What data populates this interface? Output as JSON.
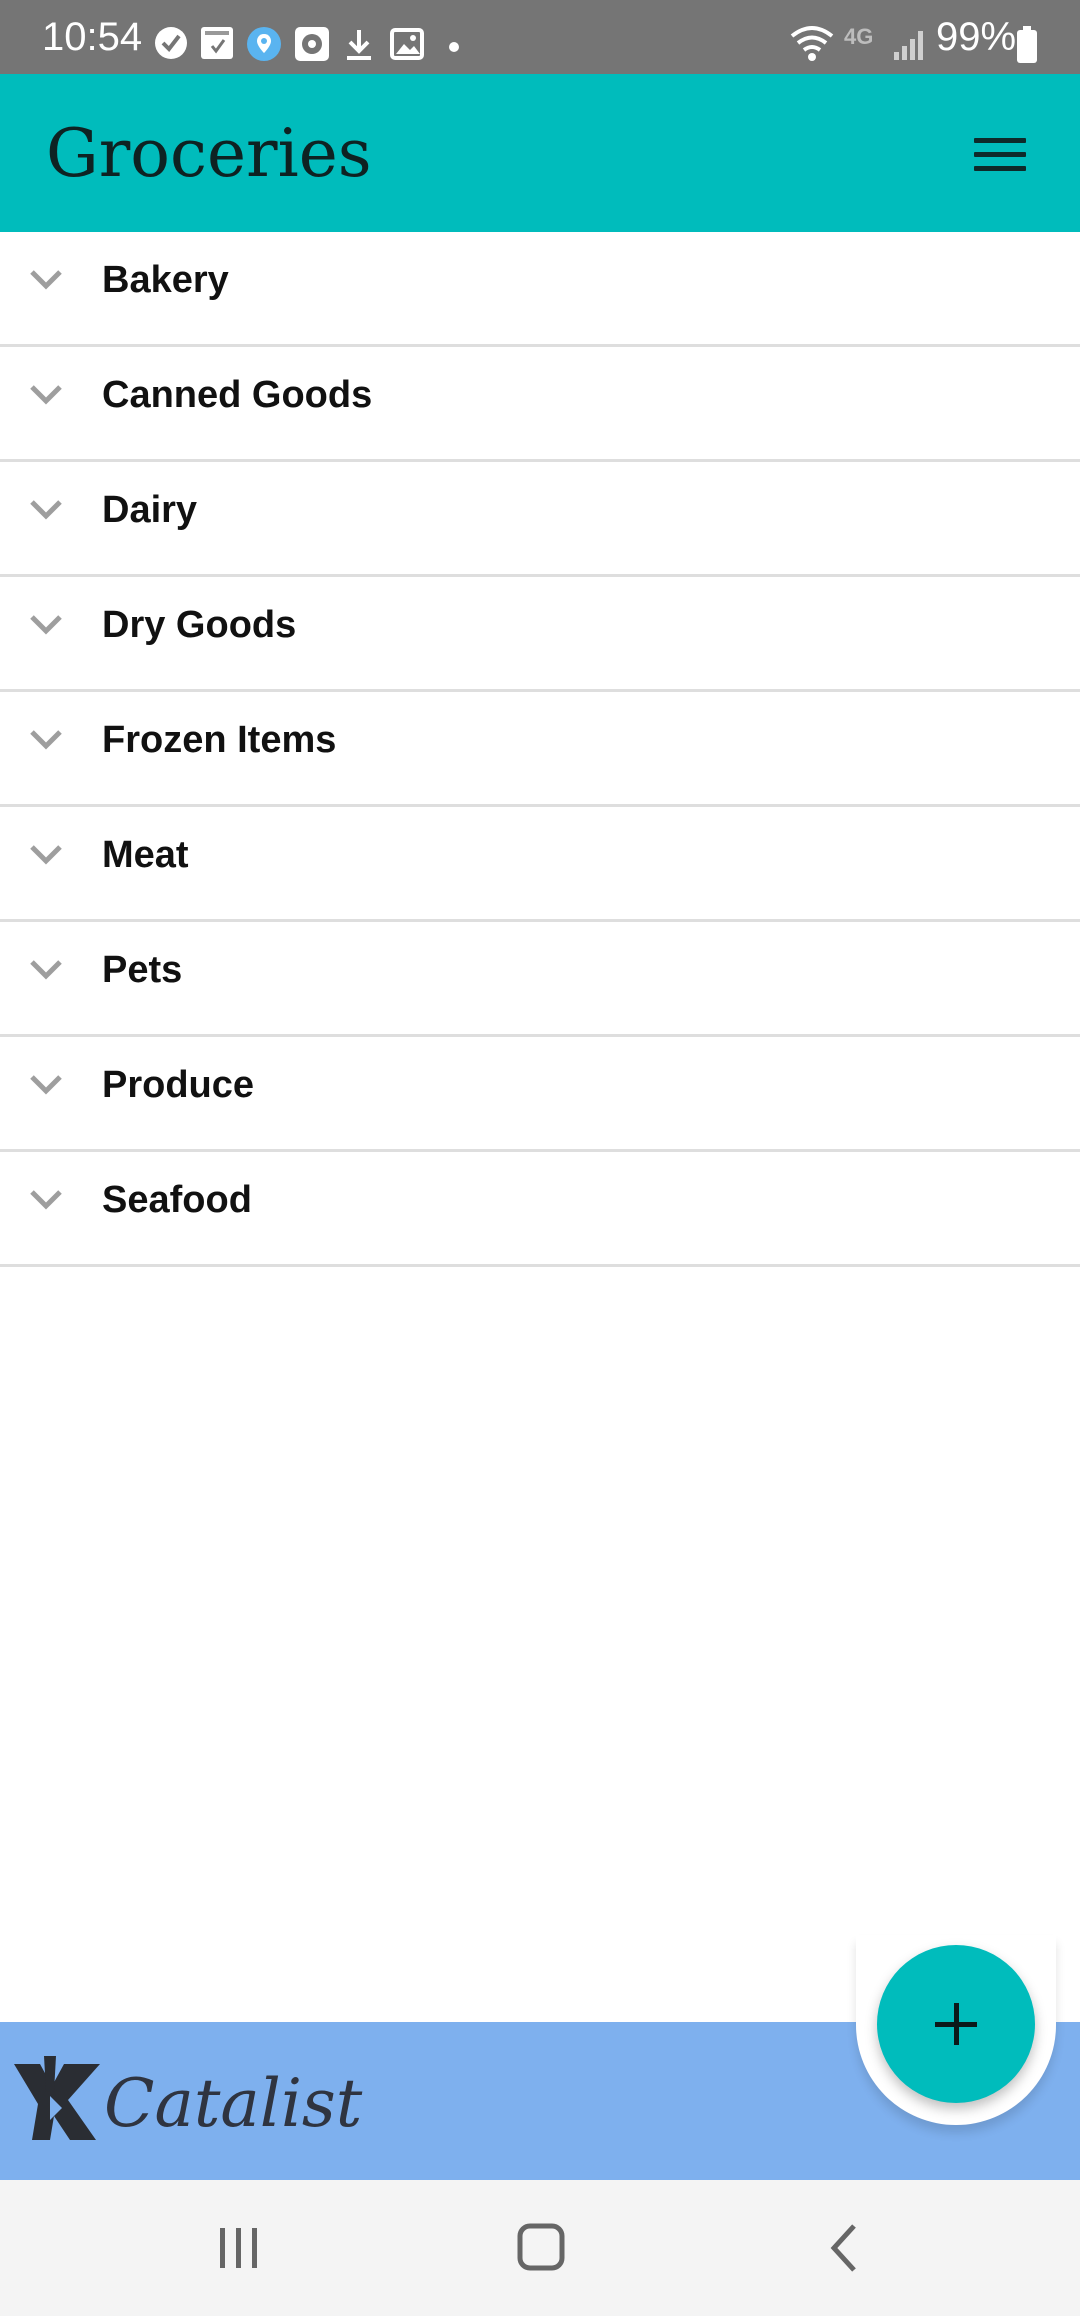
{
  "status_bar": {
    "time": "10:54",
    "battery": "99%",
    "network": "4G",
    "icons": [
      "check-circle-icon",
      "callfilter-icon",
      "location-pin-icon",
      "gallery-app-icon",
      "download-icon",
      "image-icon",
      "dot-icon",
      "wifi-icon",
      "signal-icon",
      "battery-icon"
    ]
  },
  "app_bar": {
    "title": "Groceries",
    "menu_icon": "hamburger-menu-icon",
    "color": "#00bcbc"
  },
  "categories": [
    {
      "label": "Bakery",
      "icon": "chevron-down-icon"
    },
    {
      "label": "Canned Goods",
      "icon": "chevron-down-icon"
    },
    {
      "label": "Dairy",
      "icon": "chevron-down-icon"
    },
    {
      "label": "Dry Goods",
      "icon": "chevron-down-icon"
    },
    {
      "label": "Frozen Items",
      "icon": "chevron-down-icon"
    },
    {
      "label": "Meat",
      "icon": "chevron-down-icon"
    },
    {
      "label": "Pets",
      "icon": "chevron-down-icon"
    },
    {
      "label": "Produce",
      "icon": "chevron-down-icon"
    },
    {
      "label": "Seafood",
      "icon": "chevron-down-icon"
    }
  ],
  "brand": {
    "name": "Catalist",
    "color": "#7eb0ee"
  },
  "fab": {
    "icon": "plus-icon"
  },
  "nav": {
    "recent_icon": "recent-apps-icon",
    "home_icon": "home-icon",
    "back_icon": "back-icon"
  }
}
